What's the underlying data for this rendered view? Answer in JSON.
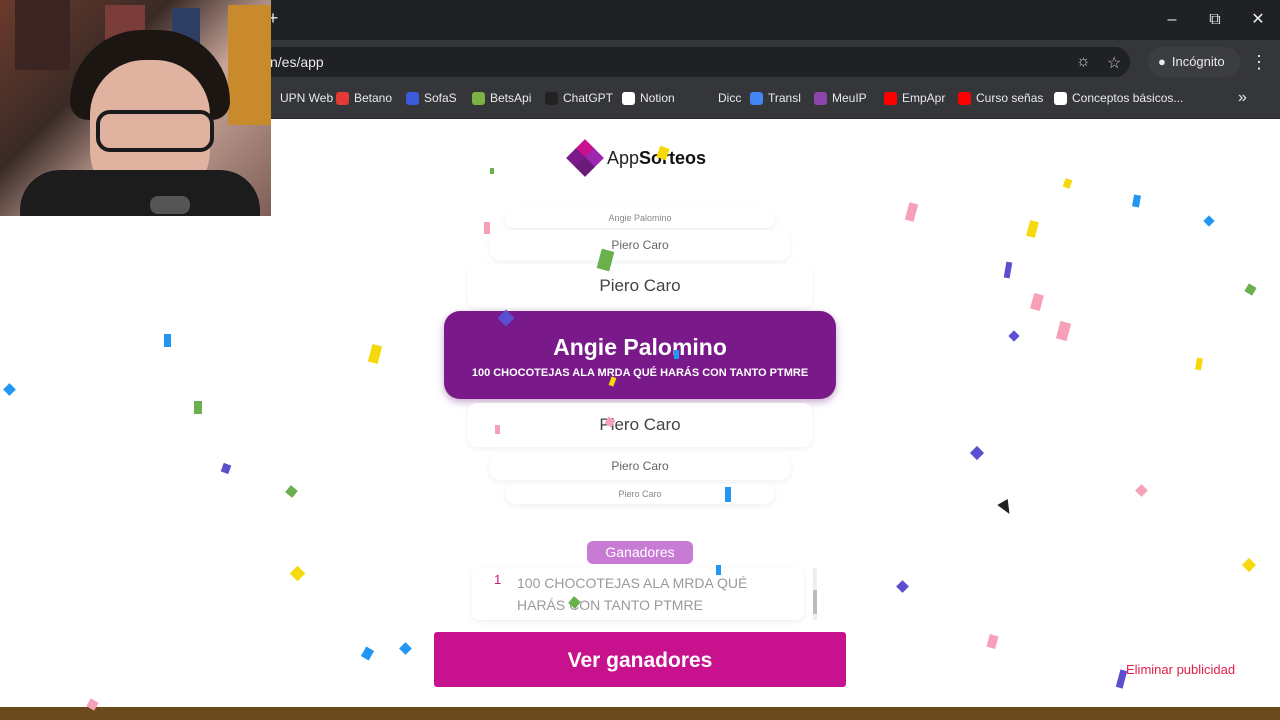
{
  "browser": {
    "url": "n/es/app",
    "incognito_label": "Incógnito",
    "bookmarks": [
      {
        "label": "UPN Web",
        "icon": "upn-icon",
        "color": "#35363a"
      },
      {
        "label": "Betano",
        "icon": "betano-icon",
        "color": "#e53935"
      },
      {
        "label": "SofaS",
        "icon": "sofascore-icon",
        "color": "#3b5bdb"
      },
      {
        "label": "BetsApi",
        "icon": "betsapi-icon",
        "color": "#7cb342"
      },
      {
        "label": "ChatGPT",
        "icon": "chatgpt-icon",
        "color": "#222222"
      },
      {
        "label": "Notion",
        "icon": "notion-icon",
        "color": "#ffffff"
      },
      {
        "label": "Dicc",
        "icon": "dicc-icon",
        "color": "#35363a"
      },
      {
        "label": "Transl",
        "icon": "translate-icon",
        "color": "#4285f4"
      },
      {
        "label": "MeuIP",
        "icon": "meuip-icon",
        "color": "#8e44ad"
      },
      {
        "label": "EmpApr",
        "icon": "youtube-icon",
        "color": "#ff0000"
      },
      {
        "label": "Curso señas",
        "icon": "youtube-icon",
        "color": "#ff0000"
      },
      {
        "label": "Conceptos básicos...",
        "icon": "google-icon",
        "color": "#ffffff"
      }
    ]
  },
  "app": {
    "logo_prefix": "App",
    "logo_suffix": "Sorteos",
    "roll_items": [
      "Angie Palomino",
      "Piero Caro",
      "Piero Caro",
      "Piero Caro",
      "Piero Caro",
      "Piero Caro"
    ],
    "winner": {
      "name": "Angie Palomino",
      "prize": "100 CHOCOTEJAS ALA MRDA QUÉ HARÁS CON TANTO PTMRE"
    },
    "winners_label": "Ganadores",
    "winners_list": [
      {
        "number": "1",
        "text": "100 CHOCOTEJAS ALA MRDA QUÉ HARÁS CON TANTO PTMRE"
      }
    ],
    "view_winners_button": "Ver ganadores",
    "remove_ads_link": "Eliminar publicidad"
  },
  "colors": {
    "brand_purple": "#7a1a8a",
    "brand_pink": "#c8128d",
    "badge_purple": "#c77bd4",
    "ad_link_red": "#e0204a"
  }
}
